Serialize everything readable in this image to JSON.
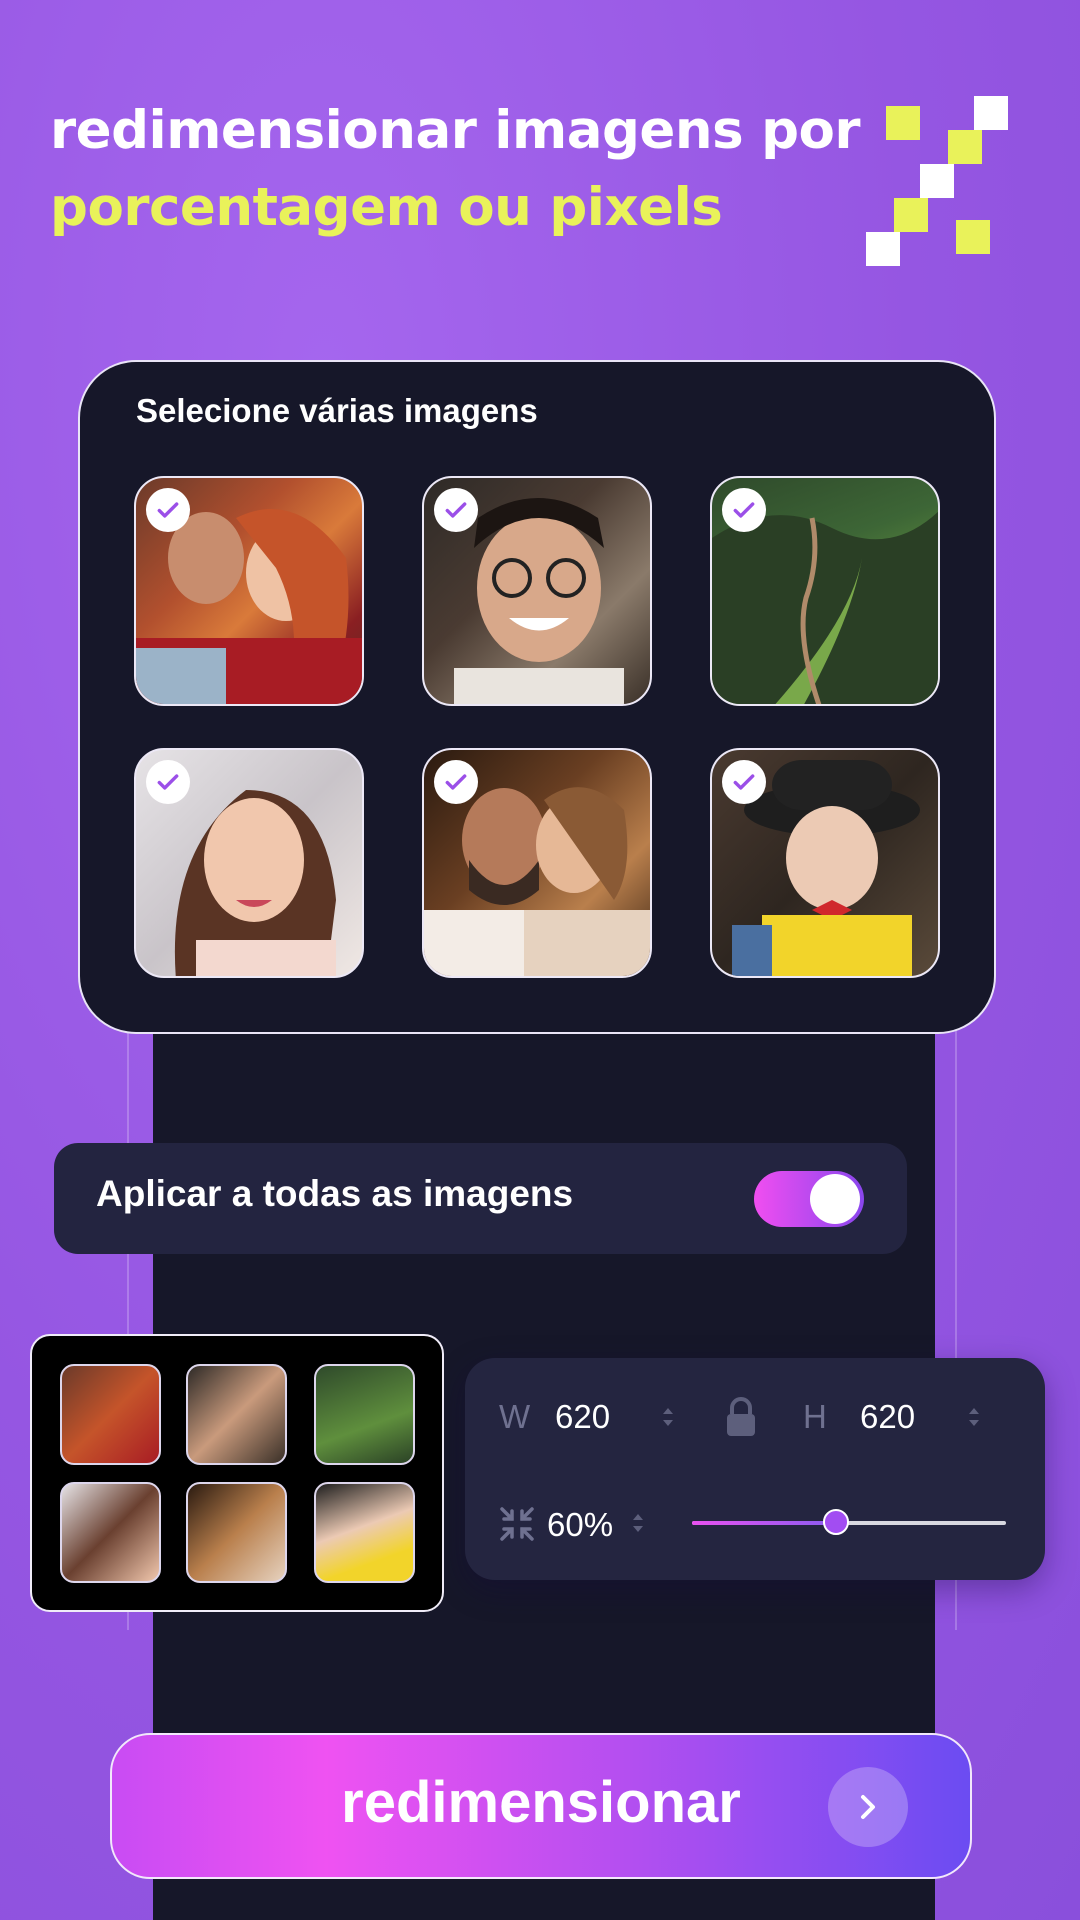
{
  "headline": {
    "line1": "redimensionar imagens por",
    "line2": "porcentagem ou pixels"
  },
  "colors": {
    "background": "#9a5ae6",
    "accent_yellow": "#e9f25a",
    "panel_dark": "#161729",
    "toggle_gradient": [
      "#f04ef0",
      "#8a46ee"
    ],
    "button_gradient": [
      "#ef52f2",
      "#6b4cf2"
    ]
  },
  "select_card": {
    "title": "Selecione várias imagens",
    "images": [
      {
        "name": "couple-photo",
        "checked": true
      },
      {
        "name": "smiling-man-glasses-photo",
        "checked": true
      },
      {
        "name": "mountain-trail-photo",
        "checked": true
      },
      {
        "name": "young-woman-photo",
        "checked": true
      },
      {
        "name": "wedding-couple-photo",
        "checked": true
      },
      {
        "name": "boy-with-hat-photo",
        "checked": true
      }
    ]
  },
  "apply_all": {
    "label": "Aplicar a todas as imagens",
    "enabled": true
  },
  "size_panel": {
    "width_label": "W",
    "width_value": "620",
    "height_label": "H",
    "height_value": "620",
    "lock_icon": "lock-icon",
    "compress_icon": "compress-icon",
    "percent_value": "60%",
    "slider_fraction": 0.46
  },
  "resize_button": {
    "label": "redimensionar",
    "icon": "chevron-right-icon"
  }
}
